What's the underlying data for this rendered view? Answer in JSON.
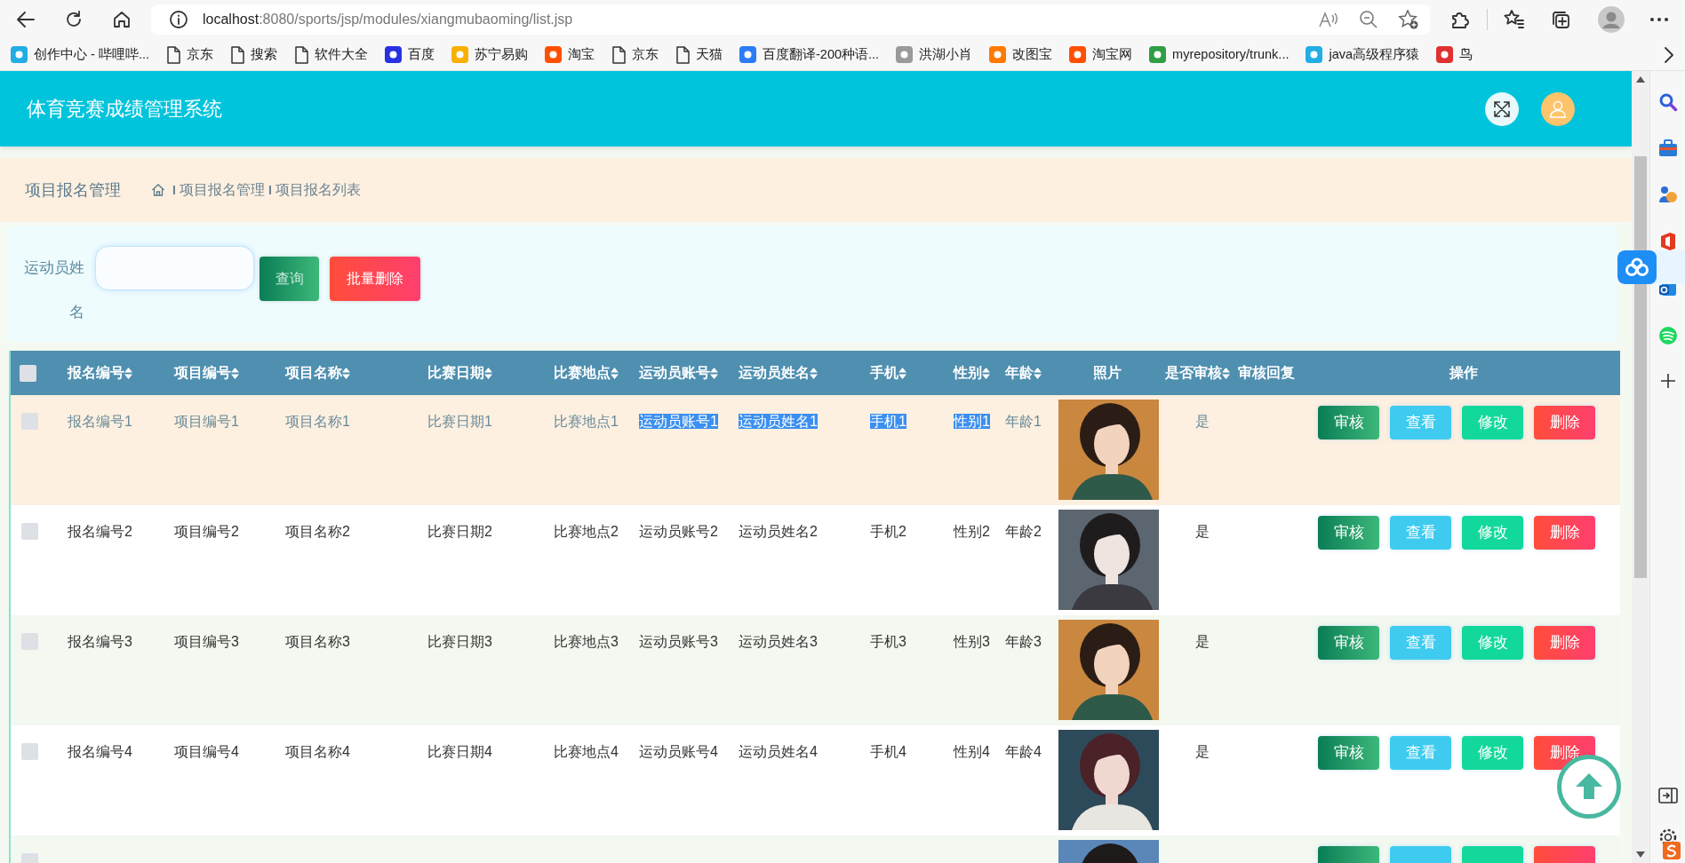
{
  "browser": {
    "address": {
      "host": "localhost",
      "path": ":8080/sports/jsp/modules/xiangmubaoming/list.jsp"
    },
    "bookmarks": [
      {
        "label": "创作中心 - 哔哩哔...",
        "kind": "site",
        "color": "#23ade5"
      },
      {
        "label": "京东",
        "kind": "page"
      },
      {
        "label": "搜索",
        "kind": "page"
      },
      {
        "label": "软件大全",
        "kind": "page"
      },
      {
        "label": "百度",
        "kind": "site",
        "color": "#2932e1"
      },
      {
        "label": "苏宁易购",
        "kind": "site",
        "color": "#f9b000"
      },
      {
        "label": "淘宝",
        "kind": "site",
        "color": "#ff5000"
      },
      {
        "label": "京东",
        "kind": "page"
      },
      {
        "label": "天猫",
        "kind": "page"
      },
      {
        "label": "百度翻译-200种语...",
        "kind": "site",
        "color": "#2b7cf6"
      },
      {
        "label": "洪湖小肖",
        "kind": "site",
        "color": "#9a9a9a"
      },
      {
        "label": "改图宝",
        "kind": "site",
        "color": "#ff7a00"
      },
      {
        "label": "淘宝网",
        "kind": "site",
        "color": "#ff5000"
      },
      {
        "label": "myrepository/trunk...",
        "kind": "site",
        "color": "#2f9e44"
      },
      {
        "label": "java高级程序猿",
        "kind": "site",
        "color": "#23ade5"
      },
      {
        "label": "鸟",
        "kind": "site",
        "color": "#e03131"
      }
    ]
  },
  "app": {
    "title": "体育竞赛成绩管理系统"
  },
  "breadcrumb": {
    "heading": "项目报名管理",
    "items": [
      {
        "separator": "I",
        "label": "项目报名管理"
      },
      {
        "separator": "I",
        "label": "项目报名列表"
      }
    ]
  },
  "search": {
    "label": "运动员姓名",
    "buttons": [
      {
        "label": "查询",
        "kind": "search"
      },
      {
        "label": "批量删除",
        "kind": "batch-delete"
      }
    ]
  },
  "table": {
    "select_all_checked": false,
    "columns": [
      {
        "label": "报名编号",
        "sortable": true
      },
      {
        "label": "项目编号",
        "sortable": true
      },
      {
        "label": "项目名称",
        "sortable": true
      },
      {
        "label": "比赛日期",
        "sortable": true
      },
      {
        "label": "比赛地点",
        "sortable": true
      },
      {
        "label": "运动员账号",
        "sortable": true
      },
      {
        "label": "运动员姓名",
        "sortable": true
      },
      {
        "label": "手机",
        "sortable": true
      },
      {
        "label": "性别",
        "sortable": true
      },
      {
        "label": "年龄",
        "sortable": true
      },
      {
        "label": "照片",
        "sortable": false
      },
      {
        "label": "是否审核",
        "sortable": true
      },
      {
        "label": "审核回复",
        "sortable": false
      },
      {
        "label": "操作",
        "sortable": false
      }
    ],
    "rows": [
      {
        "checked": false,
        "hovered": true,
        "cells": [
          {
            "text": "报名编号1",
            "highlighted": false
          },
          {
            "text": "项目编号1",
            "highlighted": false
          },
          {
            "text": "项目名称1",
            "highlighted": false
          },
          {
            "text": "比赛日期1",
            "highlighted": false
          },
          {
            "text": "比赛地点1",
            "highlighted": false
          },
          {
            "text": "运动员账号1",
            "highlighted": true
          },
          {
            "text": "运动员姓名1",
            "highlighted": true
          },
          {
            "text": "手机1",
            "highlighted": true
          },
          {
            "text": "性别1",
            "highlighted": true
          },
          {
            "text": "年龄1",
            "highlighted": false
          }
        ],
        "review_status": "是",
        "actions": [
          {
            "label": "审核",
            "kind": "review"
          },
          {
            "label": "查看",
            "kind": "view"
          },
          {
            "label": "修改",
            "kind": "edit"
          },
          {
            "label": "删除",
            "kind": "delete"
          }
        ]
      },
      {
        "checked": false,
        "hovered": false,
        "cells": [
          {
            "text": "报名编号2",
            "highlighted": false
          },
          {
            "text": "项目编号2",
            "highlighted": false
          },
          {
            "text": "项目名称2",
            "highlighted": false
          },
          {
            "text": "比赛日期2",
            "highlighted": false
          },
          {
            "text": "比赛地点2",
            "highlighted": false
          },
          {
            "text": "运动员账号2",
            "highlighted": false
          },
          {
            "text": "运动员姓名2",
            "highlighted": false
          },
          {
            "text": "手机2",
            "highlighted": false
          },
          {
            "text": "性别2",
            "highlighted": false
          },
          {
            "text": "年龄2",
            "highlighted": false
          }
        ],
        "review_status": "是",
        "actions": [
          {
            "label": "审核",
            "kind": "review"
          },
          {
            "label": "查看",
            "kind": "view"
          },
          {
            "label": "修改",
            "kind": "edit"
          },
          {
            "label": "删除",
            "kind": "delete"
          }
        ]
      },
      {
        "checked": false,
        "hovered": false,
        "cells": [
          {
            "text": "报名编号3",
            "highlighted": false
          },
          {
            "text": "项目编号3",
            "highlighted": false
          },
          {
            "text": "项目名称3",
            "highlighted": false
          },
          {
            "text": "比赛日期3",
            "highlighted": false
          },
          {
            "text": "比赛地点3",
            "highlighted": false
          },
          {
            "text": "运动员账号3",
            "highlighted": false
          },
          {
            "text": "运动员姓名3",
            "highlighted": false
          },
          {
            "text": "手机3",
            "highlighted": false
          },
          {
            "text": "性别3",
            "highlighted": false
          },
          {
            "text": "年龄3",
            "highlighted": false
          }
        ],
        "review_status": "是",
        "actions": [
          {
            "label": "审核",
            "kind": "review"
          },
          {
            "label": "查看",
            "kind": "view"
          },
          {
            "label": "修改",
            "kind": "edit"
          },
          {
            "label": "删除",
            "kind": "delete"
          }
        ]
      },
      {
        "checked": false,
        "hovered": false,
        "cells": [
          {
            "text": "报名编号4",
            "highlighted": false
          },
          {
            "text": "项目编号4",
            "highlighted": false
          },
          {
            "text": "项目名称4",
            "highlighted": false
          },
          {
            "text": "比赛日期4",
            "highlighted": false
          },
          {
            "text": "比赛地点4",
            "highlighted": false
          },
          {
            "text": "运动员账号4",
            "highlighted": false
          },
          {
            "text": "运动员姓名4",
            "highlighted": false
          },
          {
            "text": "手机4",
            "highlighted": false
          },
          {
            "text": "性别4",
            "highlighted": false
          },
          {
            "text": "年龄4",
            "highlighted": false
          }
        ],
        "review_status": "是",
        "actions": [
          {
            "label": "审核",
            "kind": "review"
          },
          {
            "label": "查看",
            "kind": "view"
          },
          {
            "label": "修改",
            "kind": "edit"
          },
          {
            "label": "删除",
            "kind": "delete"
          }
        ]
      },
      {
        "checked": false,
        "hovered": false,
        "actions": [
          {
            "kind": "review"
          },
          {
            "kind": "view"
          },
          {
            "kind": "edit"
          },
          {
            "kind": "delete"
          }
        ]
      }
    ]
  }
}
